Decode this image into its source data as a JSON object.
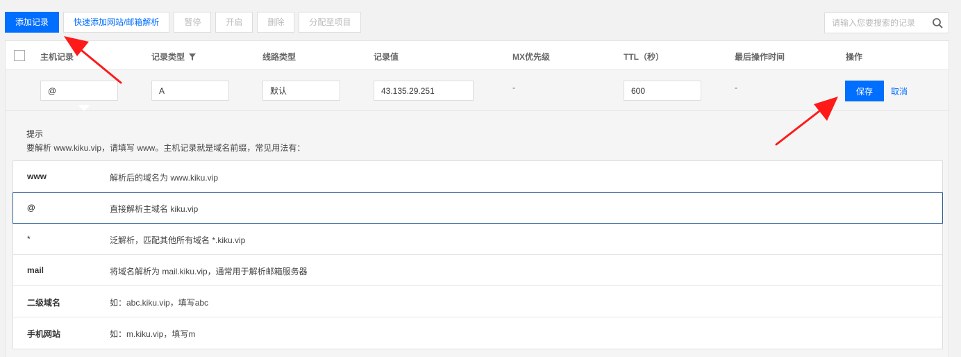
{
  "toolbar": {
    "add_record": "添加记录",
    "quick_add": "快速添加网站/邮箱解析",
    "pause": "暂停",
    "enable": "开启",
    "delete": "删除",
    "assign_project": "分配至项目"
  },
  "search": {
    "placeholder": "请输入您要搜索的记录"
  },
  "columns": {
    "host": "主机记录",
    "type": "记录类型",
    "line": "线路类型",
    "value": "记录值",
    "mx": "MX优先级",
    "ttl": "TTL（秒）",
    "last_op": "最后操作时间",
    "action": "操作"
  },
  "edit_row": {
    "host": "@",
    "type": "A",
    "line": "默认",
    "value": "43.135.29.251",
    "mx": "-",
    "ttl": "600",
    "last_op": "-",
    "save": "保存",
    "cancel": "取消"
  },
  "tips": {
    "title": "提示",
    "desc": "要解析 www.kiku.vip，请填写 www。主机记录就是域名前缀，常见用法有：",
    "items": [
      {
        "key": "www",
        "desc": "解析后的域名为 www.kiku.vip"
      },
      {
        "key": "@",
        "desc": "直接解析主域名 kiku.vip"
      },
      {
        "key": "*",
        "desc": "泛解析，匹配其他所有域名 *.kiku.vip"
      },
      {
        "key": "mail",
        "desc": "将域名解析为 mail.kiku.vip，通常用于解析邮箱服务器"
      },
      {
        "key": "二级域名",
        "desc": "如：abc.kiku.vip，填写abc"
      },
      {
        "key": "手机网站",
        "desc": "如：m.kiku.vip，填写m"
      }
    ]
  },
  "colors": {
    "primary": "#006eff",
    "arrow": "#ff1a1a",
    "active_border": "#2f5f97"
  },
  "icons": {
    "search": "search-icon",
    "filter": "filter-icon",
    "arrow": "red-arrow-annotation"
  }
}
